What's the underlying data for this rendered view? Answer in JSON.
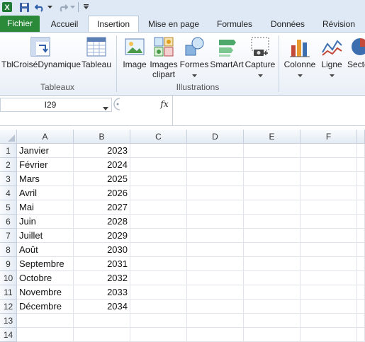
{
  "qat": {
    "icons": [
      "excel-icon",
      "save-icon",
      "undo-icon",
      "redo-icon",
      "customize-qat-icon"
    ]
  },
  "tabs": [
    {
      "key": "fichier",
      "label": "Fichier"
    },
    {
      "key": "accueil",
      "label": "Accueil"
    },
    {
      "key": "insertion",
      "label": "Insertion"
    },
    {
      "key": "mise",
      "label": "Mise en page"
    },
    {
      "key": "formules",
      "label": "Formules"
    },
    {
      "key": "donnees",
      "label": "Données"
    },
    {
      "key": "revision",
      "label": "Révision"
    }
  ],
  "active_tab": "Insertion",
  "ribbon": {
    "tableaux": {
      "label": "Tableaux",
      "tcd_label": "TblCroiséDynamique",
      "tableau_label": "Tableau"
    },
    "illustrations": {
      "label": "Illustrations",
      "image_label": "Image",
      "clipart_line1": "Images",
      "clipart_line2": "clipart",
      "formes_label": "Formes",
      "smartart_label": "SmartArt",
      "capture_label": "Capture"
    },
    "graphiques": {
      "colonne_label": "Colonne",
      "ligne_label": "Ligne",
      "secteur_label": "Secte"
    }
  },
  "formula_bar": {
    "name_box": "I29",
    "fx_label": "fx",
    "formula": ""
  },
  "columns": [
    "A",
    "B",
    "C",
    "D",
    "E",
    "F"
  ],
  "rows": [
    {
      "n": "1",
      "a": "Janvier",
      "b": "2023"
    },
    {
      "n": "2",
      "a": "Février",
      "b": "2024"
    },
    {
      "n": "3",
      "a": "Mars",
      "b": "2025"
    },
    {
      "n": "4",
      "a": "Avril",
      "b": "2026"
    },
    {
      "n": "5",
      "a": "Mai",
      "b": "2027"
    },
    {
      "n": "6",
      "a": "Juin",
      "b": "2028"
    },
    {
      "n": "7",
      "a": "Juillet",
      "b": "2029"
    },
    {
      "n": "8",
      "a": "Août",
      "b": "2030"
    },
    {
      "n": "9",
      "a": "Septembre",
      "b": "2031"
    },
    {
      "n": "10",
      "a": "Octobre",
      "b": "2032"
    },
    {
      "n": "11",
      "a": "Novembre",
      "b": "2033"
    },
    {
      "n": "12",
      "a": "Décembre",
      "b": "2034"
    },
    {
      "n": "13",
      "a": "",
      "b": ""
    },
    {
      "n": "14",
      "a": "",
      "b": ""
    }
  ],
  "colors": {
    "file_tab": "#2a8a3a",
    "ribbon_bg": "#dfe9f5",
    "grid_line": "#e0e4ea"
  }
}
